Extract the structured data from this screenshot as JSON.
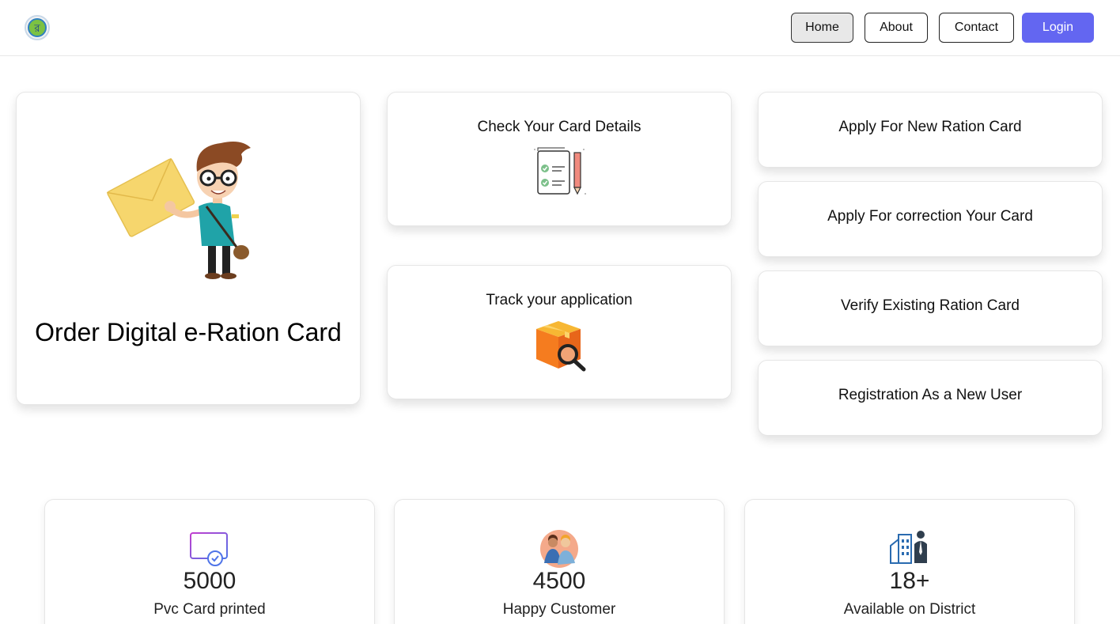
{
  "nav": {
    "items": [
      {
        "label": "Home"
      },
      {
        "label": "About"
      },
      {
        "label": "Contact"
      },
      {
        "label": "Login"
      }
    ]
  },
  "hero": {
    "title": "Order Digital e-Ration Card"
  },
  "middle_cards": [
    {
      "title": "Check Your Card Details",
      "icon": "document-check-icon"
    },
    {
      "title": "Track your application",
      "icon": "package-search-icon"
    }
  ],
  "right_cards": [
    {
      "title": "Apply For New Ration Card"
    },
    {
      "title": "Apply For correction Your Card"
    },
    {
      "title": "Verify Existing Ration Card"
    },
    {
      "title": "Registration As a New User"
    }
  ],
  "stats": [
    {
      "value": "5000",
      "label": "Pvc Card printed",
      "icon": "card-check-icon"
    },
    {
      "value": "4500",
      "label": "Happy Customer",
      "icon": "customers-icon"
    },
    {
      "value": "18+",
      "label": "Available on District",
      "icon": "district-building-icon"
    }
  ],
  "colors": {
    "accent": "#6366f1",
    "active_nav_bg": "#e8e8e8"
  }
}
